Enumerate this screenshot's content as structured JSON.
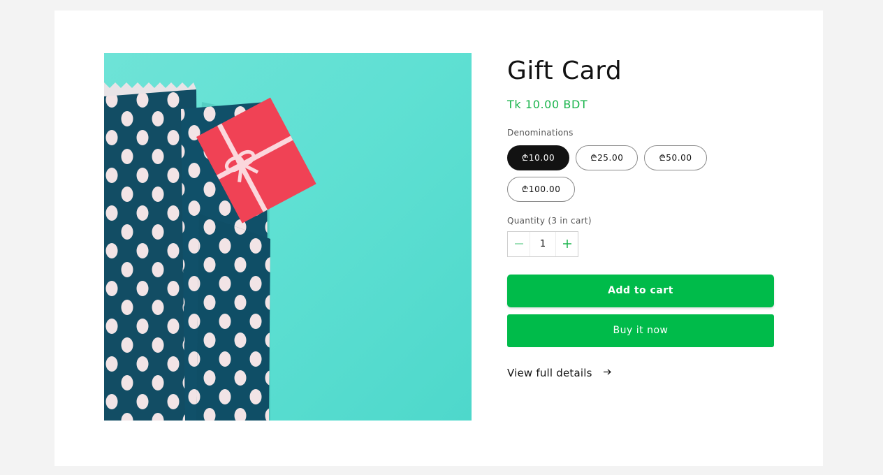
{
  "product": {
    "title": "Gift Card",
    "price": "Tk 10.00 BDT",
    "image_alt": "gift-card-envelope-image"
  },
  "denominations": {
    "label": "Denominations",
    "options": [
      "₾10.00",
      "₾25.00",
      "₾50.00",
      "₾100.00"
    ],
    "selected": "₾10.00"
  },
  "quantity": {
    "label": "Quantity (3 in cart)",
    "value": "1",
    "minus_icon": "minus-icon",
    "plus_icon": "plus-icon"
  },
  "actions": {
    "add_to_cart": "Add to cart",
    "buy_now": "Buy it now",
    "view_details": "View full details",
    "view_details_icon": "arrow-right-icon"
  },
  "colors": {
    "accent": "#00bb4a",
    "price": "#1ab44c",
    "selected_pill": "#121212",
    "page_bg": "#f3f3f3"
  }
}
